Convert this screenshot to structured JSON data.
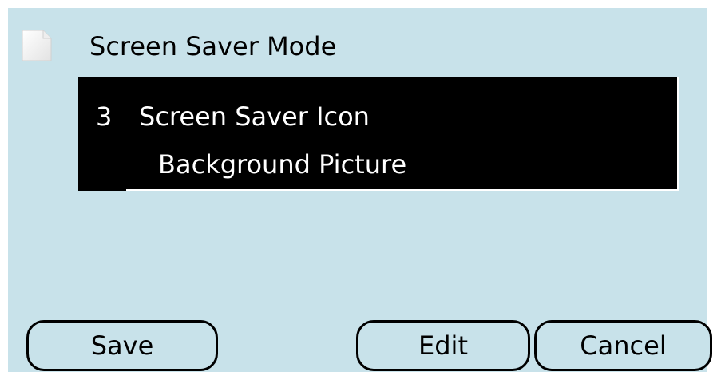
{
  "header": {
    "title": "Screen Saver Mode",
    "icon": "document-icon"
  },
  "list": {
    "items": [
      {
        "number": "3",
        "label": "Screen Saver Icon"
      },
      {
        "number": "",
        "label": "Background Picture"
      }
    ],
    "selected_index": 0
  },
  "buttons": {
    "save_label": "Save",
    "edit_label": "Edit",
    "cancel_label": "Cancel"
  },
  "colors": {
    "panel_background": "#c8e2ea",
    "list_background": "#000000",
    "list_text": "#ffffff",
    "button_border": "#000000"
  }
}
